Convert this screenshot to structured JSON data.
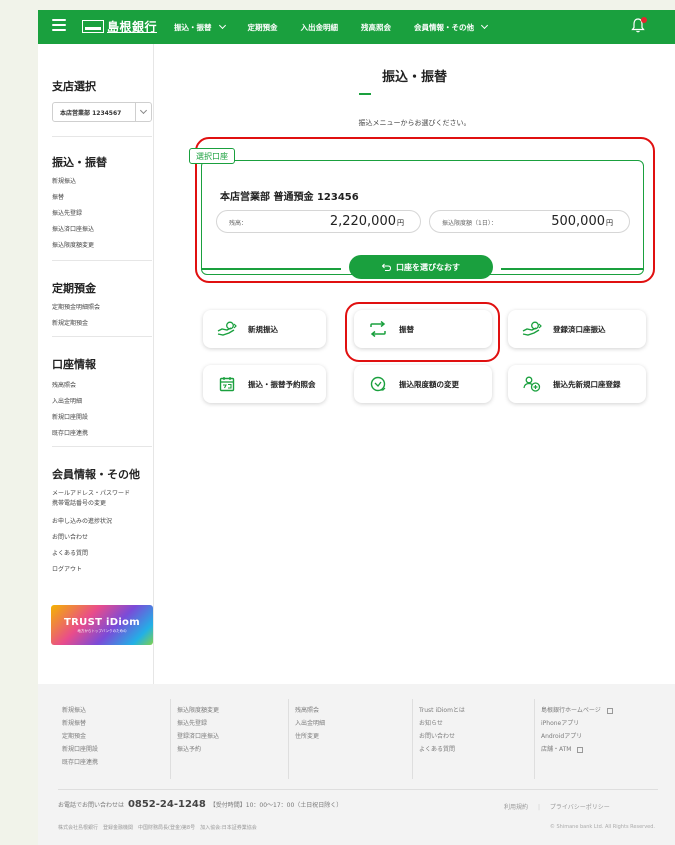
{
  "header": {
    "bank_name": "島根銀行",
    "nav": [
      "振込・振替",
      "定期預金",
      "入出金明細",
      "残高照会",
      "会員情報・その他"
    ]
  },
  "sidebar": {
    "branch_title": "支店選択",
    "branch_value": "本店営業部 1234567",
    "sections": [
      {
        "title": "振込・振替",
        "items": [
          "新規振込",
          "振替",
          "振込先登録",
          "振込済口座振込",
          "振込限度額変更"
        ]
      },
      {
        "title": "定期預金",
        "items": [
          "定期預金明細照会",
          "新規定期預金"
        ]
      },
      {
        "title": "口座情報",
        "items": [
          "残高照会",
          "入出金明細",
          "新規口座開設",
          "既存口座連携"
        ]
      },
      {
        "title": "会員情報・その他",
        "items": [
          "メールアドレス・パスワード",
          "携帯電話番号の変更",
          "お申し込みの進捗状況",
          "お問い合わせ",
          "よくある質問",
          "ログアウト"
        ]
      }
    ],
    "banner_title": "TRUST iDiom",
    "banner_sub": "地方からトップバンクのための"
  },
  "main": {
    "title": "振込・振替",
    "subtitle": "振込メニューからお選びください。",
    "account_tag": "選択口座",
    "account_name": "本店営業部 普通預金 123456",
    "balance_label": "残高：",
    "balance_value": "2,220,000",
    "limit_label": "振込限度額（1日）：",
    "limit_value": "500,000",
    "currency": "円",
    "reselect_label": "口座を選びなおす",
    "actions": [
      {
        "label": "新規振込",
        "icon": "hand-money-icon"
      },
      {
        "label": "振替",
        "icon": "transfer-arrows-icon"
      },
      {
        "label": "登録済口座振込",
        "icon": "hand-money-icon"
      },
      {
        "label": "振込・振替予約照会",
        "icon": "calendar-icon"
      },
      {
        "label": "振込限度額の変更",
        "icon": "gauge-icon"
      },
      {
        "label": "振込先新規口座登録",
        "icon": "add-user-icon"
      }
    ]
  },
  "footer": {
    "columns": [
      [
        "新規振込",
        "新規振替",
        "定期預金",
        "新規口座開設",
        "既存口座連携"
      ],
      [
        "振込限度額変更",
        "振込先登録",
        "登録済口座振込",
        "振込予約"
      ],
      [
        "残高照会",
        "入出金明細",
        "住所変更"
      ],
      [
        "Trust iDiomとは",
        "お知らせ",
        "お問い合わせ",
        "よくある質問"
      ],
      [
        "島根銀行ホームページ",
        "iPhoneアプリ",
        "Androidアプリ",
        "店舗・ATM"
      ]
    ],
    "phone_prefix": "お電話でお問い合わせは",
    "phone_number": "0852-24-1248",
    "phone_hours": "【受付時間】10：00～17：00（土日祝日除く）",
    "terms": "利用規約",
    "privacy": "プライバシーポリシー",
    "company": "株式会社島根銀行　登録金融機関　中国財務局長(登金)第8号　加入協会:日本証券業協会",
    "copyright": "© Shimane bank Ltd. All Rights Reserved."
  },
  "colors": {
    "brand": "#1aa03e",
    "highlight": "#e01010",
    "notify": "#e4262d"
  }
}
